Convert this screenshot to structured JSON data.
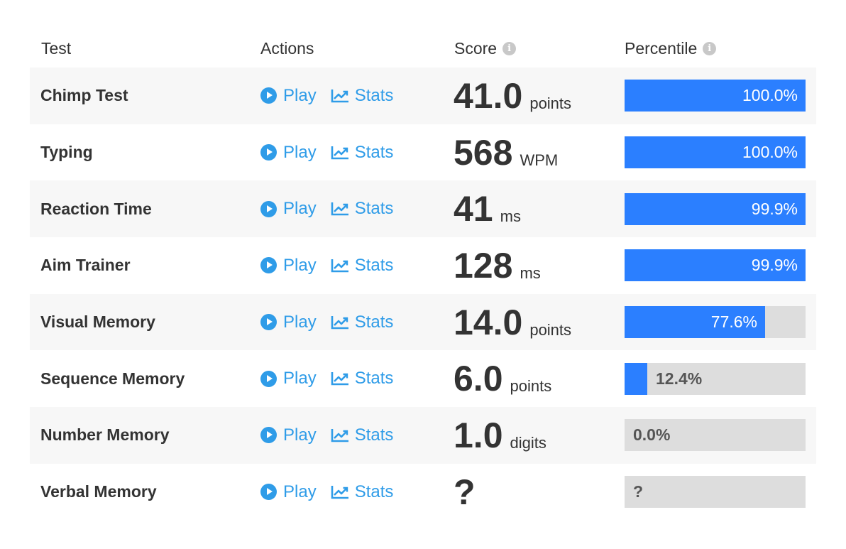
{
  "header": {
    "test": "Test",
    "actions": "Actions",
    "score": "Score",
    "percentile": "Percentile"
  },
  "labels": {
    "play": "Play",
    "stats": "Stats"
  },
  "colors": {
    "accent_link": "#2f9ce8",
    "bar_fill": "#2b7fff",
    "bar_track": "#dddddd",
    "row_alt": "#f7f7f7"
  },
  "icons": [
    "info-icon",
    "play-icon",
    "stats-chart-icon"
  ],
  "rows": [
    {
      "test": "Chimp Test",
      "score": "41.0",
      "unit": "points",
      "percentile_label": "100.0%",
      "percentile": 1.0
    },
    {
      "test": "Typing",
      "score": "568",
      "unit": "WPM",
      "percentile_label": "100.0%",
      "percentile": 1.0
    },
    {
      "test": "Reaction Time",
      "score": "41",
      "unit": "ms",
      "percentile_label": "99.9%",
      "percentile": 0.999
    },
    {
      "test": "Aim Trainer",
      "score": "128",
      "unit": "ms",
      "percentile_label": "99.9%",
      "percentile": 0.999
    },
    {
      "test": "Visual Memory",
      "score": "14.0",
      "unit": "points",
      "percentile_label": "77.6%",
      "percentile": 0.776
    },
    {
      "test": "Sequence Memory",
      "score": "6.0",
      "unit": "points",
      "percentile_label": "12.4%",
      "percentile": 0.124
    },
    {
      "test": "Number Memory",
      "score": "1.0",
      "unit": "digits",
      "percentile_label": "0.0%",
      "percentile": 0.0
    },
    {
      "test": "Verbal Memory",
      "score": "?",
      "unit": "",
      "percentile_label": "?",
      "percentile": 0.0
    }
  ]
}
